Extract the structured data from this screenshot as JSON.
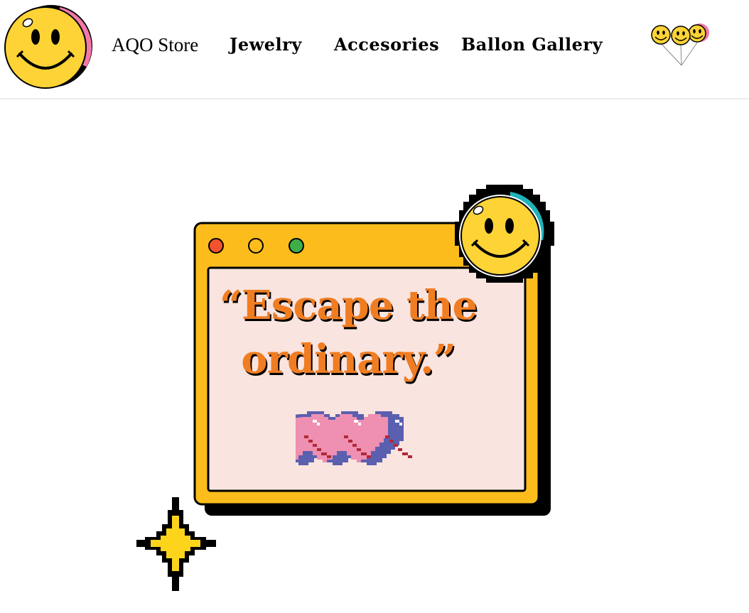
{
  "header": {
    "store_name": "AQO Store",
    "nav": [
      {
        "label": "Jewelry"
      },
      {
        "label": "Accesories"
      },
      {
        "label": "Ballon Gallery"
      }
    ]
  },
  "hero": {
    "quote_line1": "“Escape the",
    "quote_line2": "ordinary.”"
  },
  "colors": {
    "window_yellow": "#fcbd1c",
    "window_inner": "#f9e4df",
    "quote_orange": "#f07d22",
    "smiley_yellow": "#fdd335",
    "heart_pink": "#ef8fb1",
    "heart_border": "#5b5fb0"
  },
  "icons": [
    "smiley-logo-icon",
    "smiley-balloons-icon",
    "window-dot-red-icon",
    "window-dot-yellow-icon",
    "window-dot-green-icon",
    "smiley-sticker-icon",
    "pixel-hearts-icon",
    "sparkle-star-icon"
  ]
}
